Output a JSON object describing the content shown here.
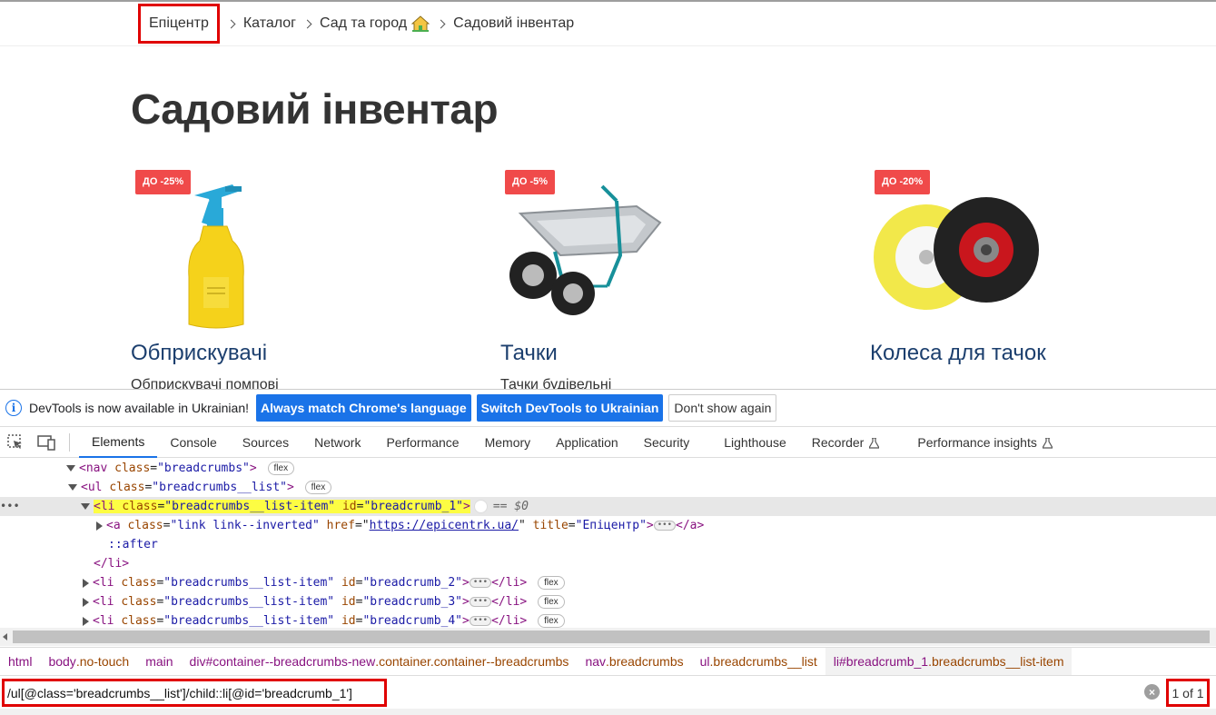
{
  "site": {
    "breadcrumbs": [
      {
        "label": "Епіцентр"
      },
      {
        "label": "Каталог"
      },
      {
        "label": "Сад та город"
      },
      {
        "label": "Садовий інвентар"
      }
    ],
    "page_title": "Садовий інвентар",
    "cards": [
      {
        "badge": "ДО -25%",
        "title": "Обприскувачі",
        "subtitle": "Обприскувачі помпові"
      },
      {
        "badge": "ДО -5%",
        "title": "Тачки",
        "subtitle": "Тачки будівельні"
      },
      {
        "badge": "ДО -20%",
        "title": "Колеса для тачок",
        "subtitle": ""
      }
    ]
  },
  "devtools": {
    "infobar": {
      "message": "DevTools is now available in Ukrainian!",
      "btn_match": "Always match Chrome's language",
      "btn_switch": "Switch DevTools to Ukrainian",
      "btn_dismiss": "Don't show again"
    },
    "tabs": [
      "Elements",
      "Console",
      "Sources",
      "Network",
      "Performance",
      "Memory",
      "Application",
      "Security",
      "Lighthouse",
      "Recorder",
      "Performance insights"
    ],
    "active_tab": "Elements",
    "dom": {
      "nav_open": "<nav",
      "nav_class_attr": "class",
      "nav_class_val": "\"breadcrumbs\"",
      "ul_class_val": "\"breadcrumbs__list\"",
      "li_class_val": "\"breadcrumbs__list-item\"",
      "li1_id": "\"breadcrumb_1\"",
      "li2_id": "\"breadcrumb_2\"",
      "li3_id": "\"breadcrumb_3\"",
      "li4_id": "\"breadcrumb_4\"",
      "a_class_val": "\"link link--inverted\"",
      "a_href": "https://epicentrk.ua/",
      "a_title": "\"Епіцентр\"",
      "after": "::after",
      "eq": "== $0",
      "flex": "flex"
    },
    "crumbs": [
      {
        "tag": "html",
        "cls": ""
      },
      {
        "tag": "body",
        "cls": ".no-touch"
      },
      {
        "tag": "main",
        "cls": ""
      },
      {
        "tag": "div#container--breadcrumbs-new",
        "cls": ".container.container--breadcrumbs"
      },
      {
        "tag": "nav",
        "cls": ".breadcrumbs"
      },
      {
        "tag": "ul",
        "cls": ".breadcrumbs__list"
      },
      {
        "tag": "li#breadcrumb_1",
        "cls": ".breadcrumbs__list-item"
      }
    ],
    "search": {
      "query": "/ul[@class='breadcrumbs__list']/child::li[@id='breadcrumb_1']",
      "match_count": "1 of 1"
    }
  },
  "colors": {
    "highlight_red": "#e00000",
    "badge_red": "#f04a4a",
    "devtools_blue": "#1a73e8",
    "title_blue": "#1c3f6e"
  }
}
